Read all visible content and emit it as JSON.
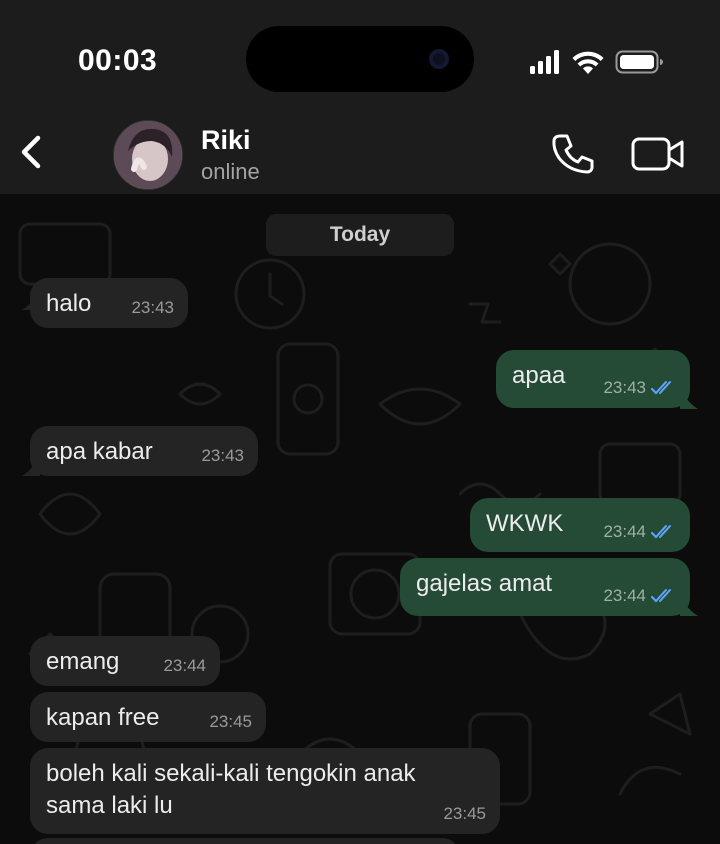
{
  "status_bar": {
    "time": "00:03"
  },
  "header": {
    "contact_name": "Riki",
    "contact_status": "online",
    "icons": {
      "back": "chevron-left-icon",
      "call": "phone-icon",
      "video": "video-camera-icon"
    }
  },
  "chat": {
    "date_label": "Today",
    "messages": [
      {
        "direction": "in",
        "text": "halo",
        "time": "23:43"
      },
      {
        "direction": "out",
        "text": "apaa",
        "time": "23:43",
        "status": "read"
      },
      {
        "direction": "in",
        "text": "apa kabar",
        "time": "23:43"
      },
      {
        "direction": "out",
        "text": "WKWK",
        "time": "23:44",
        "status": "read"
      },
      {
        "direction": "out",
        "text": "gajelas amat",
        "time": "23:44",
        "status": "read"
      },
      {
        "direction": "in",
        "text": "emang",
        "time": "23:44"
      },
      {
        "direction": "in",
        "text": "kapan free",
        "time": "23:45"
      },
      {
        "direction": "in",
        "text_line1": "boleh kali sekali-kali tengokin anak",
        "text_line2": "sama laki lu",
        "time": "23:45"
      }
    ]
  },
  "colors": {
    "incoming_bubble": "#242424",
    "outgoing_bubble": "#254b37",
    "read_ticks": "#5ea6ff",
    "header_bg": "#1c1c1c"
  }
}
